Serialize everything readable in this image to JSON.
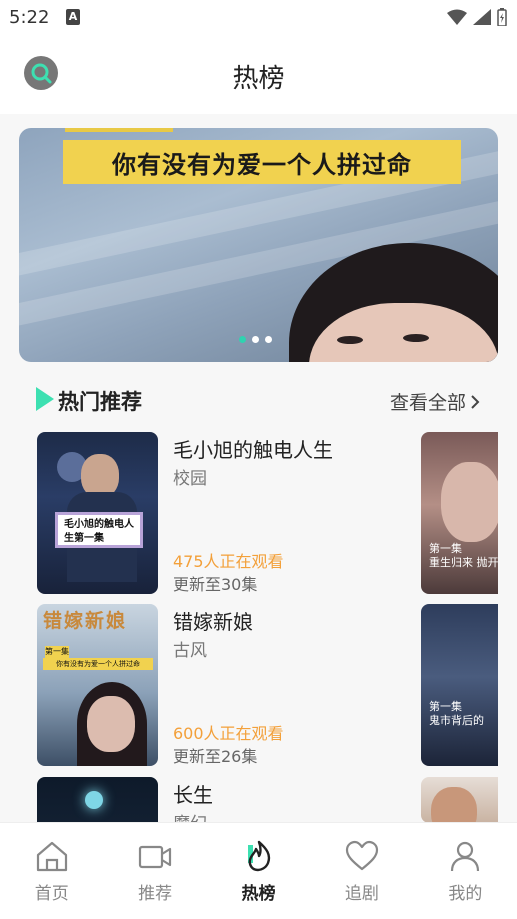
{
  "status_bar": {
    "time": "5:22",
    "notif_letter": "A"
  },
  "header": {
    "title": "热榜"
  },
  "banner": {
    "caption": "你有没有为爱一个人拼过命",
    "dots": 3,
    "active_dot": 0
  },
  "section": {
    "title": "热门推荐",
    "see_all": "查看全部"
  },
  "items": [
    {
      "title": "毛小旭的触电人生",
      "tag": "校园",
      "watching": "475人正在观看",
      "update": "更新至30集",
      "poster_caption": "毛小旭的触电人生第一集"
    },
    {
      "title": "错嫁新娘",
      "tag": "古风",
      "watching": "600人正在观看",
      "update": "更新至26集",
      "poster_heading": "错嫁新娘",
      "poster_ep": "第一集",
      "poster_caption": "你有没有为爱一个人拼过命"
    },
    {
      "title": "长生",
      "tag": "魔幻"
    }
  ],
  "side_cards": [
    {
      "sub1": "第一集",
      "sub2": "重生归来 抛开"
    },
    {
      "sub1": "第一集",
      "sub2": "鬼市背后的"
    }
  ],
  "tabs": [
    {
      "label": "首页",
      "icon": "home-icon"
    },
    {
      "label": "推荐",
      "icon": "video-icon"
    },
    {
      "label": "热榜",
      "icon": "flame-icon",
      "active": true
    },
    {
      "label": "追剧",
      "icon": "heart-icon"
    },
    {
      "label": "我的",
      "icon": "user-icon"
    }
  ],
  "colors": {
    "accent": "#2fd3b0",
    "watching": "#f3a03a",
    "banner_caption_bg": "#f1d24f"
  }
}
